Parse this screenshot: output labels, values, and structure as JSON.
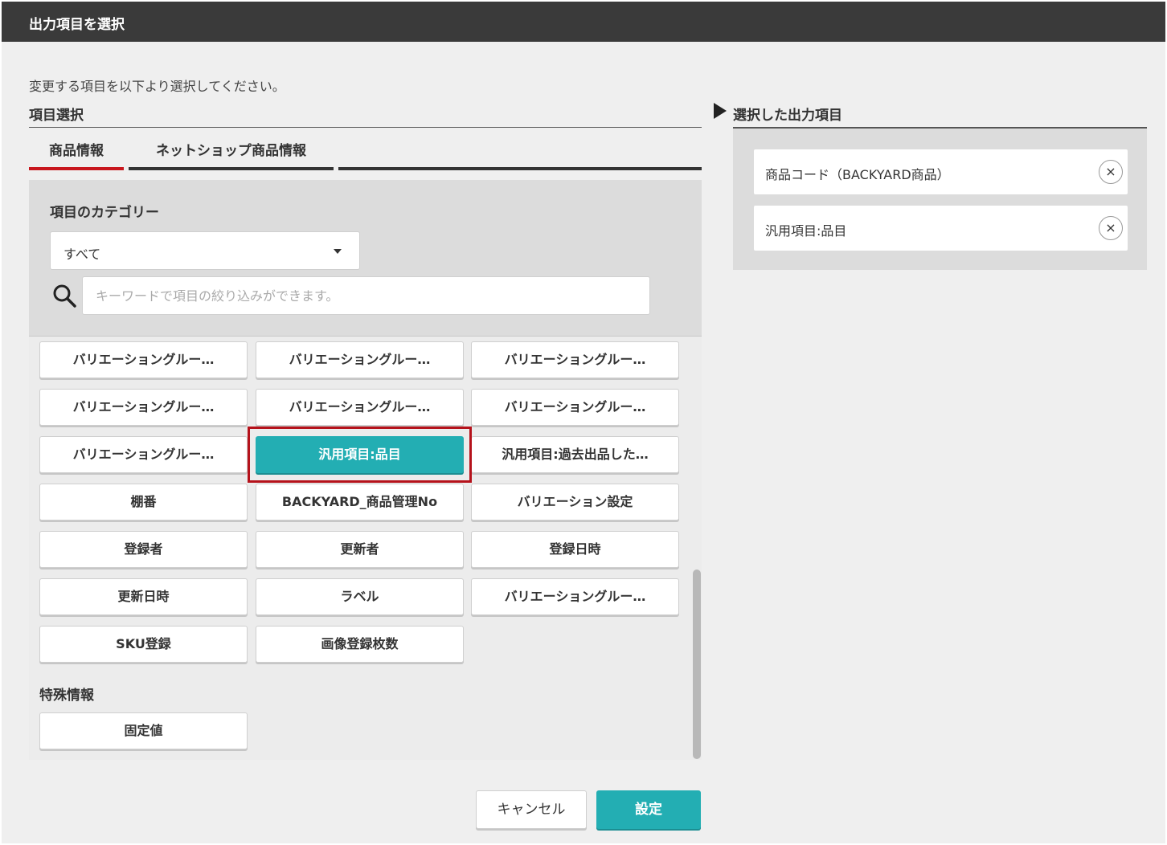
{
  "dialog": {
    "title": "出力項目を選択",
    "instruction": "変更する項目を以下より選択してください。",
    "section_label": "項目選択"
  },
  "tabs": [
    {
      "label": "商品情報",
      "active": true
    },
    {
      "label": "ネットショップ商品情報",
      "active": false
    },
    {
      "label": "",
      "active": false
    }
  ],
  "filter": {
    "category_label": "項目のカテゴリー",
    "category_selected": "すべて",
    "search_placeholder": "キーワードで項目の絞り込みができます。"
  },
  "items": [
    {
      "label": "バリエーショングルー…"
    },
    {
      "label": "バリエーショングルー…"
    },
    {
      "label": "バリエーショングルー…"
    },
    {
      "label": "バリエーショングルー…"
    },
    {
      "label": "バリエーショングルー…"
    },
    {
      "label": "バリエーショングルー…"
    },
    {
      "label": "バリエーショングルー…"
    },
    {
      "label": "汎用項目:品目",
      "selected": true
    },
    {
      "label": "汎用項目:過去出品した…"
    },
    {
      "label": "棚番"
    },
    {
      "label": "BACKYARD_商品管理No"
    },
    {
      "label": "バリエーション設定"
    },
    {
      "label": "登録者"
    },
    {
      "label": "更新者"
    },
    {
      "label": "登録日時"
    },
    {
      "label": "更新日時"
    },
    {
      "label": "ラベル"
    },
    {
      "label": "バリエーショングルー…"
    },
    {
      "label": "SKU登録"
    },
    {
      "label": "画像登録枚数"
    }
  ],
  "special": {
    "label": "特殊情報",
    "items": [
      {
        "label": "固定値"
      }
    ]
  },
  "selected_panel": {
    "label": "選択した出力項目",
    "items": [
      {
        "label": "商品コード（BACKYARD商品）",
        "remove": "×"
      },
      {
        "label": "汎用項目:品目",
        "remove": "×"
      }
    ]
  },
  "buttons": {
    "cancel": "キャンセル",
    "ok": "設定"
  },
  "colors": {
    "accent": "#23aeb3",
    "titlebar": "#3a3a3a",
    "active_tab": "#c8161d",
    "highlight": "#b5121b"
  }
}
